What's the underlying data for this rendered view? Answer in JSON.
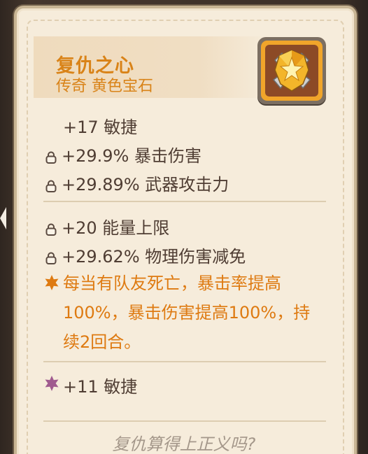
{
  "item": {
    "name": "复仇之心",
    "subtitle": "传奇 黄色宝石",
    "icon": "golden-star-shield-gem-icon"
  },
  "stats": {
    "base": "+17 敏捷",
    "locked_group_1": [
      "+29.9% 暴击伤害",
      "+29.89% 武器攻击力"
    ],
    "locked_group_2": [
      "+20 能量上限",
      "+29.62% 物理伤害减免"
    ],
    "special_effect": "每当有队友死亡，暴击率提高100%，暴击伤害提高100%，持续2回合。",
    "socket_bonus": "+11 敏捷"
  },
  "flavor_text": "复仇算得上正义吗?",
  "colors": {
    "legendary_orange": "#de7a11",
    "stat_text": "#4f3d33",
    "card_bg": "#f6ecdb",
    "flavor_gray": "#a4978a",
    "socket_purple": "#a05b8f"
  }
}
